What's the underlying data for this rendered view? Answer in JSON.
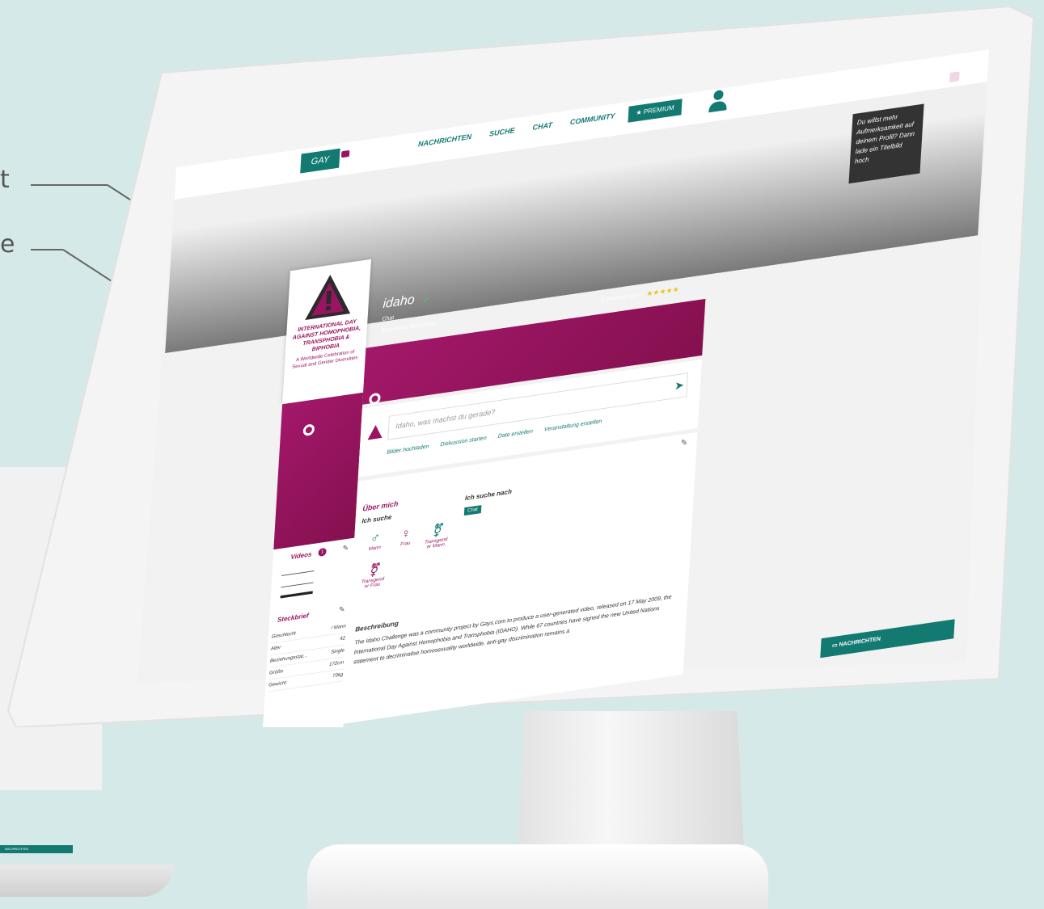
{
  "callouts": {
    "top": "t",
    "bottom": "e"
  },
  "header": {
    "logo": "GAY",
    "nav": [
      "NACHRICHTEN",
      "SUCHE",
      "CHAT",
      "COMMUNITY"
    ],
    "premium": "★ PREMIUM"
  },
  "cover_hint": "Du willst mehr Aufmerksamkeit auf deinem Profil? Dann lade ein Titelbild hoch",
  "profile": {
    "avatar_title": "INTERNATIONAL DAY AGAINST HOMOPHOBIA, TRANSPHOBIA & BIPHOBIA",
    "avatar_sub": "A Worldwide Celebration of Sexual and Gender Diversities",
    "name": "idaho",
    "status": "Chat",
    "location": "Barcelona, Barcelona",
    "ratings": "5 Bewertungen",
    "stars": "★★★★★"
  },
  "post": {
    "placeholder": "Idaho, was machst du gerade?",
    "actions": [
      "Bilder hochladen",
      "Diskussion starten",
      "Date erstellen",
      "Veranstaltung erstellen"
    ]
  },
  "about": {
    "title": "Über mich",
    "seeking_title": "Ich suche",
    "seeking_for_title": "Ich suche nach",
    "seeking_for_tag": "Chat",
    "genders": [
      "Mann",
      "Frau",
      "Transgend er Mann",
      "Transgend er Frau"
    ],
    "description_title": "Beschreibung",
    "description": "The Idaho Challenge was a community project by Gays.com to produce a user-generated video, released on 17 May 2009, the International Day Against Homophobia and Transphobia (IDAHO). While 67 countries have signed the new United Nations statement to decriminalise homosexuality worldwide, anti-gay discrimination remains a"
  },
  "videos": {
    "title": "Videos",
    "count": "1"
  },
  "steckbrief": {
    "title": "Steckbrief",
    "rows": [
      {
        "k": "Geschlecht",
        "v": "♂Mann"
      },
      {
        "k": "Alter",
        "v": "42"
      },
      {
        "k": "Beziehungsstat...",
        "v": "Single"
      },
      {
        "k": "Größe",
        "v": "172cm"
      },
      {
        "k": "Gewicht",
        "v": "73kg"
      }
    ]
  },
  "messages_bar": "NACHRICHTEN",
  "laptop_bar": "NACHRICHTEN",
  "colors": {
    "teal": "#137a72",
    "magenta": "#9b1463",
    "bg": "#d5eae8"
  }
}
